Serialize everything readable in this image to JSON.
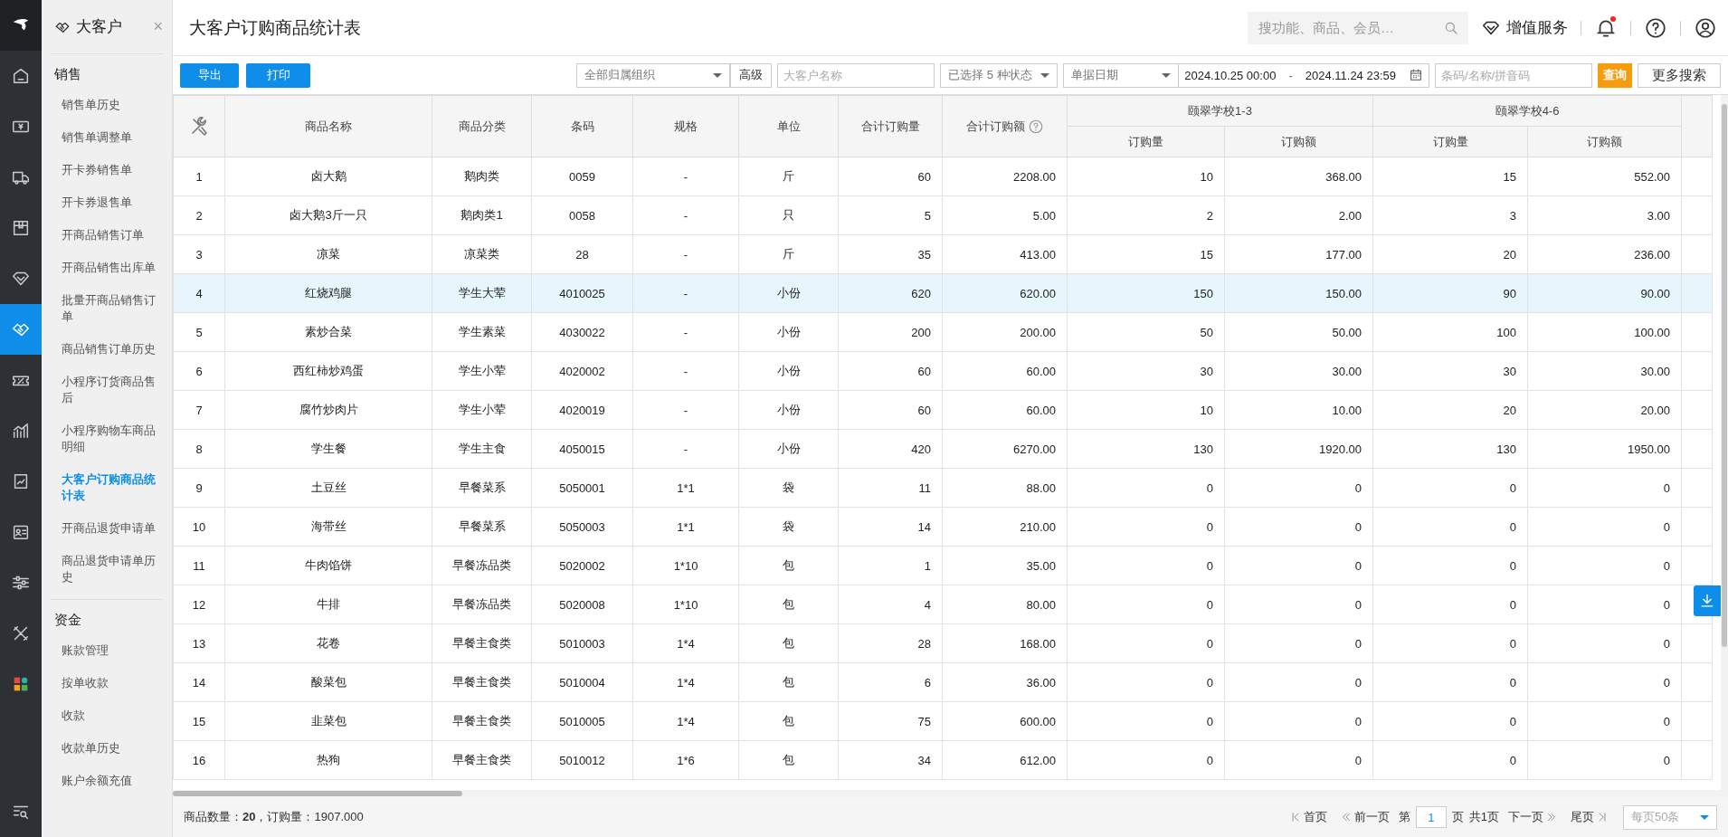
{
  "icon_rail": {
    "items": [
      {
        "kind": "logo",
        "selected": false
      },
      {
        "kind": "home",
        "selected": false
      },
      {
        "kind": "money",
        "selected": false
      },
      {
        "kind": "truck",
        "selected": false
      },
      {
        "kind": "box",
        "selected": false
      },
      {
        "kind": "diamond",
        "selected": false
      },
      {
        "kind": "handshake",
        "selected": true
      },
      {
        "kind": "coupon",
        "selected": false
      },
      {
        "kind": "chart",
        "selected": false
      },
      {
        "kind": "report",
        "selected": false
      },
      {
        "kind": "card",
        "selected": false
      },
      {
        "kind": "sliders",
        "selected": false
      },
      {
        "kind": "tools",
        "selected": false
      },
      {
        "kind": "apps",
        "selected": false
      },
      {
        "kind": "list-search",
        "selected": false
      }
    ]
  },
  "nav": {
    "title": "大客户",
    "close": "×",
    "sections": [
      {
        "heading": "销售",
        "items": [
          {
            "label": "销售单历史",
            "selected": false
          },
          {
            "label": "销售单调整单",
            "selected": false
          },
          {
            "label": "开卡券销售单",
            "selected": false
          },
          {
            "label": "开卡券退售单",
            "selected": false
          },
          {
            "label": "开商品销售订单",
            "selected": false
          },
          {
            "label": "开商品销售出库单",
            "selected": false
          },
          {
            "label": "批量开商品销售订单",
            "selected": false
          },
          {
            "label": "商品销售订单历史",
            "selected": false
          },
          {
            "label": "小程序订货商品售后",
            "selected": false
          },
          {
            "label": "小程序购物车商品明细",
            "selected": false
          },
          {
            "label": "大客户订购商品统计表",
            "selected": true
          },
          {
            "label": "开商品退货申请单",
            "selected": false
          },
          {
            "label": "商品退货申请单历史",
            "selected": false
          }
        ]
      },
      {
        "heading": "资金",
        "items": [
          {
            "label": "账款管理",
            "selected": false
          },
          {
            "label": "按单收款",
            "selected": false
          },
          {
            "label": "收款",
            "selected": false
          },
          {
            "label": "收款单历史",
            "selected": false
          },
          {
            "label": "账户余额充值",
            "selected": false
          }
        ]
      }
    ]
  },
  "header": {
    "title": "大客户订购商品统计表",
    "search": {
      "placeholder": "搜功能、商品、会员…"
    },
    "service": "增值服务",
    "notification_unread": true
  },
  "toolbar": {
    "buttons": [
      "导出",
      "打印"
    ],
    "org_select": "全部归属组织",
    "advanced": "高级",
    "customer": {
      "placeholder": "大客户名称"
    },
    "status_select": "已选择 5 种状态",
    "date_type": "单据日期",
    "date_from": "2024.10.25 00:00",
    "date_sep": "-",
    "date_to": "2024.11.24 23:59",
    "code": {
      "placeholder": "条码/名称/拼音码"
    },
    "query": "查询",
    "more": "更多搜索"
  },
  "table": {
    "columns": [
      {
        "label": "商品名称",
        "kind": "plain"
      },
      {
        "label": "商品分类",
        "kind": "plain"
      },
      {
        "label": "条码",
        "kind": "plain"
      },
      {
        "label": "规格",
        "kind": "plain"
      },
      {
        "label": "单位",
        "kind": "plain"
      },
      {
        "label": "合计订购量",
        "kind": "plain"
      },
      {
        "label": "合计订购额",
        "kind": "help"
      }
    ],
    "groups": [
      {
        "name": "颐翠学校1-3",
        "columns": [
          "订购量",
          "订购额"
        ]
      },
      {
        "name": "颐翠学校4-6",
        "columns": [
          "订购量",
          "订购额"
        ]
      }
    ],
    "rows": [
      {
        "index": "1",
        "selected": false,
        "cells": [
          "卤大鹅",
          "鹅肉类",
          "0059",
          "-",
          "斤",
          "60",
          "2208.00",
          "10",
          "368.00",
          "15",
          "552.00"
        ]
      },
      {
        "index": "2",
        "selected": false,
        "cells": [
          "卤大鹅3斤一只",
          "鹅肉类1",
          "0058",
          "-",
          "只",
          "5",
          "5.00",
          "2",
          "2.00",
          "3",
          "3.00"
        ]
      },
      {
        "index": "3",
        "selected": false,
        "cells": [
          "凉菜",
          "凉菜类",
          "28",
          "-",
          "斤",
          "35",
          "413.00",
          "15",
          "177.00",
          "20",
          "236.00"
        ]
      },
      {
        "index": "4",
        "selected": true,
        "cells": [
          "红烧鸡腿",
          "学生大荤",
          "4010025",
          "-",
          "小份",
          "620",
          "620.00",
          "150",
          "150.00",
          "90",
          "90.00"
        ]
      },
      {
        "index": "5",
        "selected": false,
        "cells": [
          "素炒合菜",
          "学生素菜",
          "4030022",
          "-",
          "小份",
          "200",
          "200.00",
          "50",
          "50.00",
          "100",
          "100.00"
        ]
      },
      {
        "index": "6",
        "selected": false,
        "cells": [
          "西红柿炒鸡蛋",
          "学生小荤",
          "4020002",
          "-",
          "小份",
          "60",
          "60.00",
          "30",
          "30.00",
          "30",
          "30.00"
        ]
      },
      {
        "index": "7",
        "selected": false,
        "cells": [
          "腐竹炒肉片",
          "学生小荤",
          "4020019",
          "-",
          "小份",
          "60",
          "60.00",
          "10",
          "10.00",
          "20",
          "20.00"
        ]
      },
      {
        "index": "8",
        "selected": false,
        "cells": [
          "学生餐",
          "学生主食",
          "4050015",
          "-",
          "小份",
          "420",
          "6270.00",
          "130",
          "1920.00",
          "130",
          "1950.00"
        ]
      },
      {
        "index": "9",
        "selected": false,
        "cells": [
          "土豆丝",
          "早餐菜系",
          "5050001",
          "1*1",
          "袋",
          "11",
          "88.00",
          "0",
          "0",
          "0",
          "0"
        ]
      },
      {
        "index": "10",
        "selected": false,
        "cells": [
          "海带丝",
          "早餐菜系",
          "5050003",
          "1*1",
          "袋",
          "14",
          "210.00",
          "0",
          "0",
          "0",
          "0"
        ]
      },
      {
        "index": "11",
        "selected": false,
        "cells": [
          "牛肉馅饼",
          "早餐冻品类",
          "5020002",
          "1*10",
          "包",
          "1",
          "35.00",
          "0",
          "0",
          "0",
          "0"
        ]
      },
      {
        "index": "12",
        "selected": false,
        "cells": [
          "牛排",
          "早餐冻品类",
          "5020008",
          "1*10",
          "包",
          "4",
          "80.00",
          "0",
          "0",
          "0",
          "0"
        ]
      },
      {
        "index": "13",
        "selected": false,
        "cells": [
          "花卷",
          "早餐主食类",
          "5010003",
          "1*4",
          "包",
          "28",
          "168.00",
          "0",
          "0",
          "0",
          "0"
        ]
      },
      {
        "index": "14",
        "selected": false,
        "cells": [
          "酸菜包",
          "早餐主食类",
          "5010004",
          "1*4",
          "包",
          "6",
          "36.00",
          "0",
          "0",
          "0",
          "0"
        ]
      },
      {
        "index": "15",
        "selected": false,
        "cells": [
          "韭菜包",
          "早餐主食类",
          "5010005",
          "1*4",
          "包",
          "75",
          "600.00",
          "0",
          "0",
          "0",
          "0"
        ]
      },
      {
        "index": "16",
        "selected": false,
        "cells": [
          "热狗",
          "早餐主食类",
          "5010012",
          "1*6",
          "包",
          "34",
          "612.00",
          "0",
          "0",
          "0",
          "0"
        ]
      }
    ]
  },
  "footer": {
    "summary": "商品数量：**20**，订购量：1907.000",
    "first": "首页",
    "prev": "前一页",
    "page_pre": "第",
    "page": "1",
    "page_post": "页",
    "total": "共1页",
    "next": "下一页",
    "last": "尾页",
    "page_size": "每页50条"
  }
}
